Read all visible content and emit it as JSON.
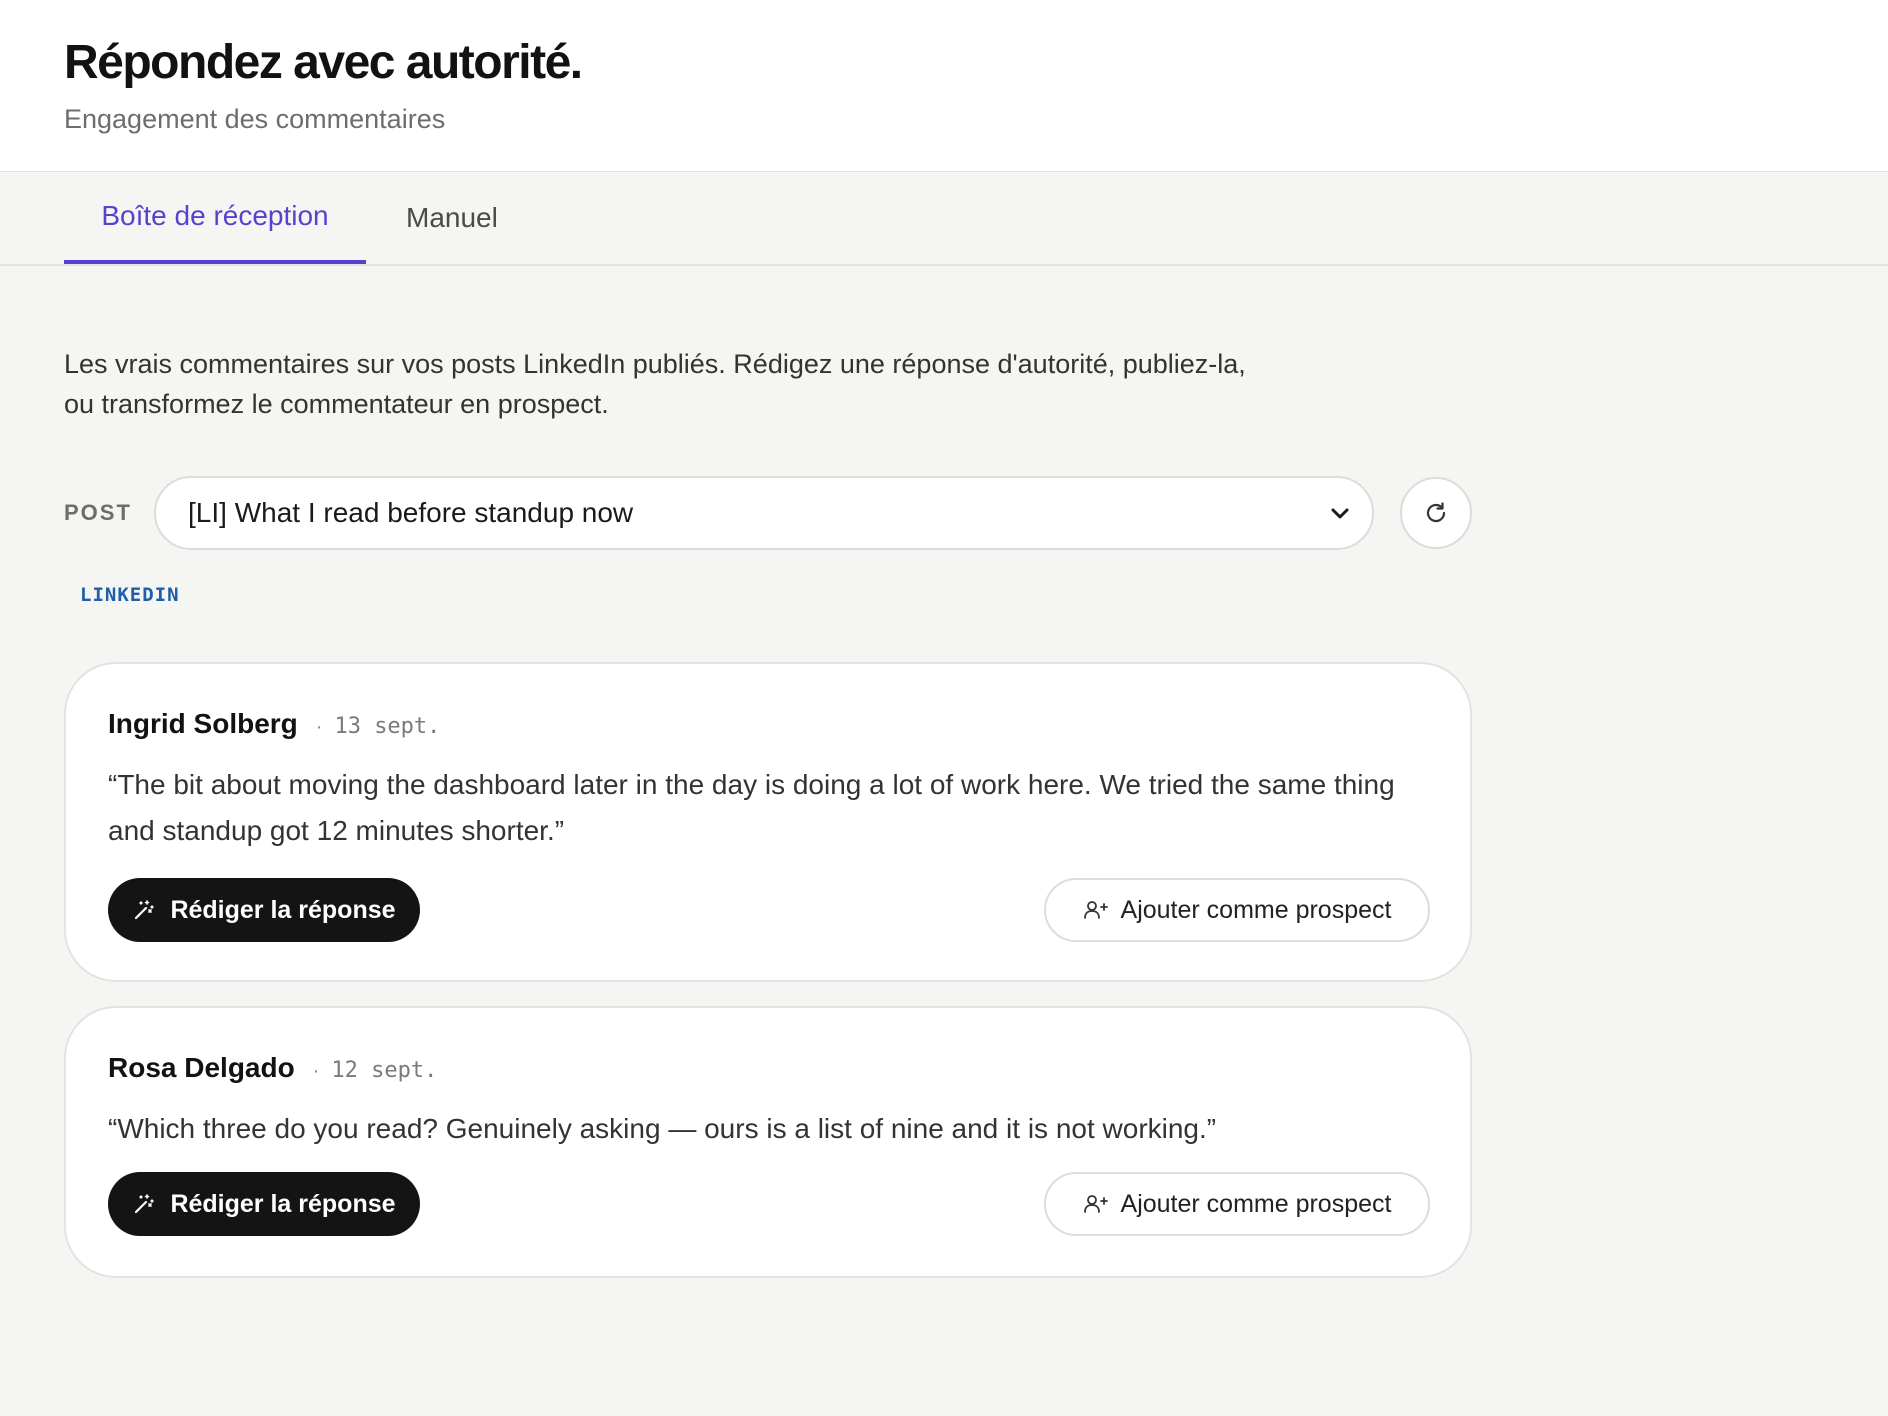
{
  "header": {
    "title": "Répondez avec autorité.",
    "subtitle": "Engagement des commentaires"
  },
  "tabs": [
    {
      "label": "Boîte de réception",
      "active": true
    },
    {
      "label": "Manuel",
      "active": false
    }
  ],
  "intro": "Les vrais commentaires sur vos posts LinkedIn publiés. Rédigez une réponse d'autorité, publiez-la, ou transformez le commentateur en prospect.",
  "post_selector": {
    "label": "POST",
    "selected": "[LI] What I read before standup now",
    "platform": "LINKEDIN"
  },
  "comments": [
    {
      "author": "Ingrid Solberg",
      "separator": "·",
      "date": "13 sept.",
      "text": "“The bit about moving the dashboard later in the day is doing a lot of work here. We tried the same thing and standup got 12 minutes shorter.”",
      "draft_label": "Rédiger la réponse",
      "prospect_label": "Ajouter comme prospect"
    },
    {
      "author": "Rosa Delgado",
      "separator": "·",
      "date": "12 sept.",
      "text": "“Which three do you read? Genuinely asking — ours is a list of nine and it is not working.”",
      "draft_label": "Rédiger la réponse",
      "prospect_label": "Ajouter comme prospect"
    }
  ],
  "colors": {
    "accent": "#5a3fd0",
    "platform": "#1e5fa8",
    "primary_button": "#141414",
    "background": "#f5f5f3"
  },
  "icons": {
    "select_caret": "chevron-down-icon",
    "refresh": "refresh-icon",
    "draft": "magic-wand-icon",
    "prospect": "user-plus-icon"
  }
}
